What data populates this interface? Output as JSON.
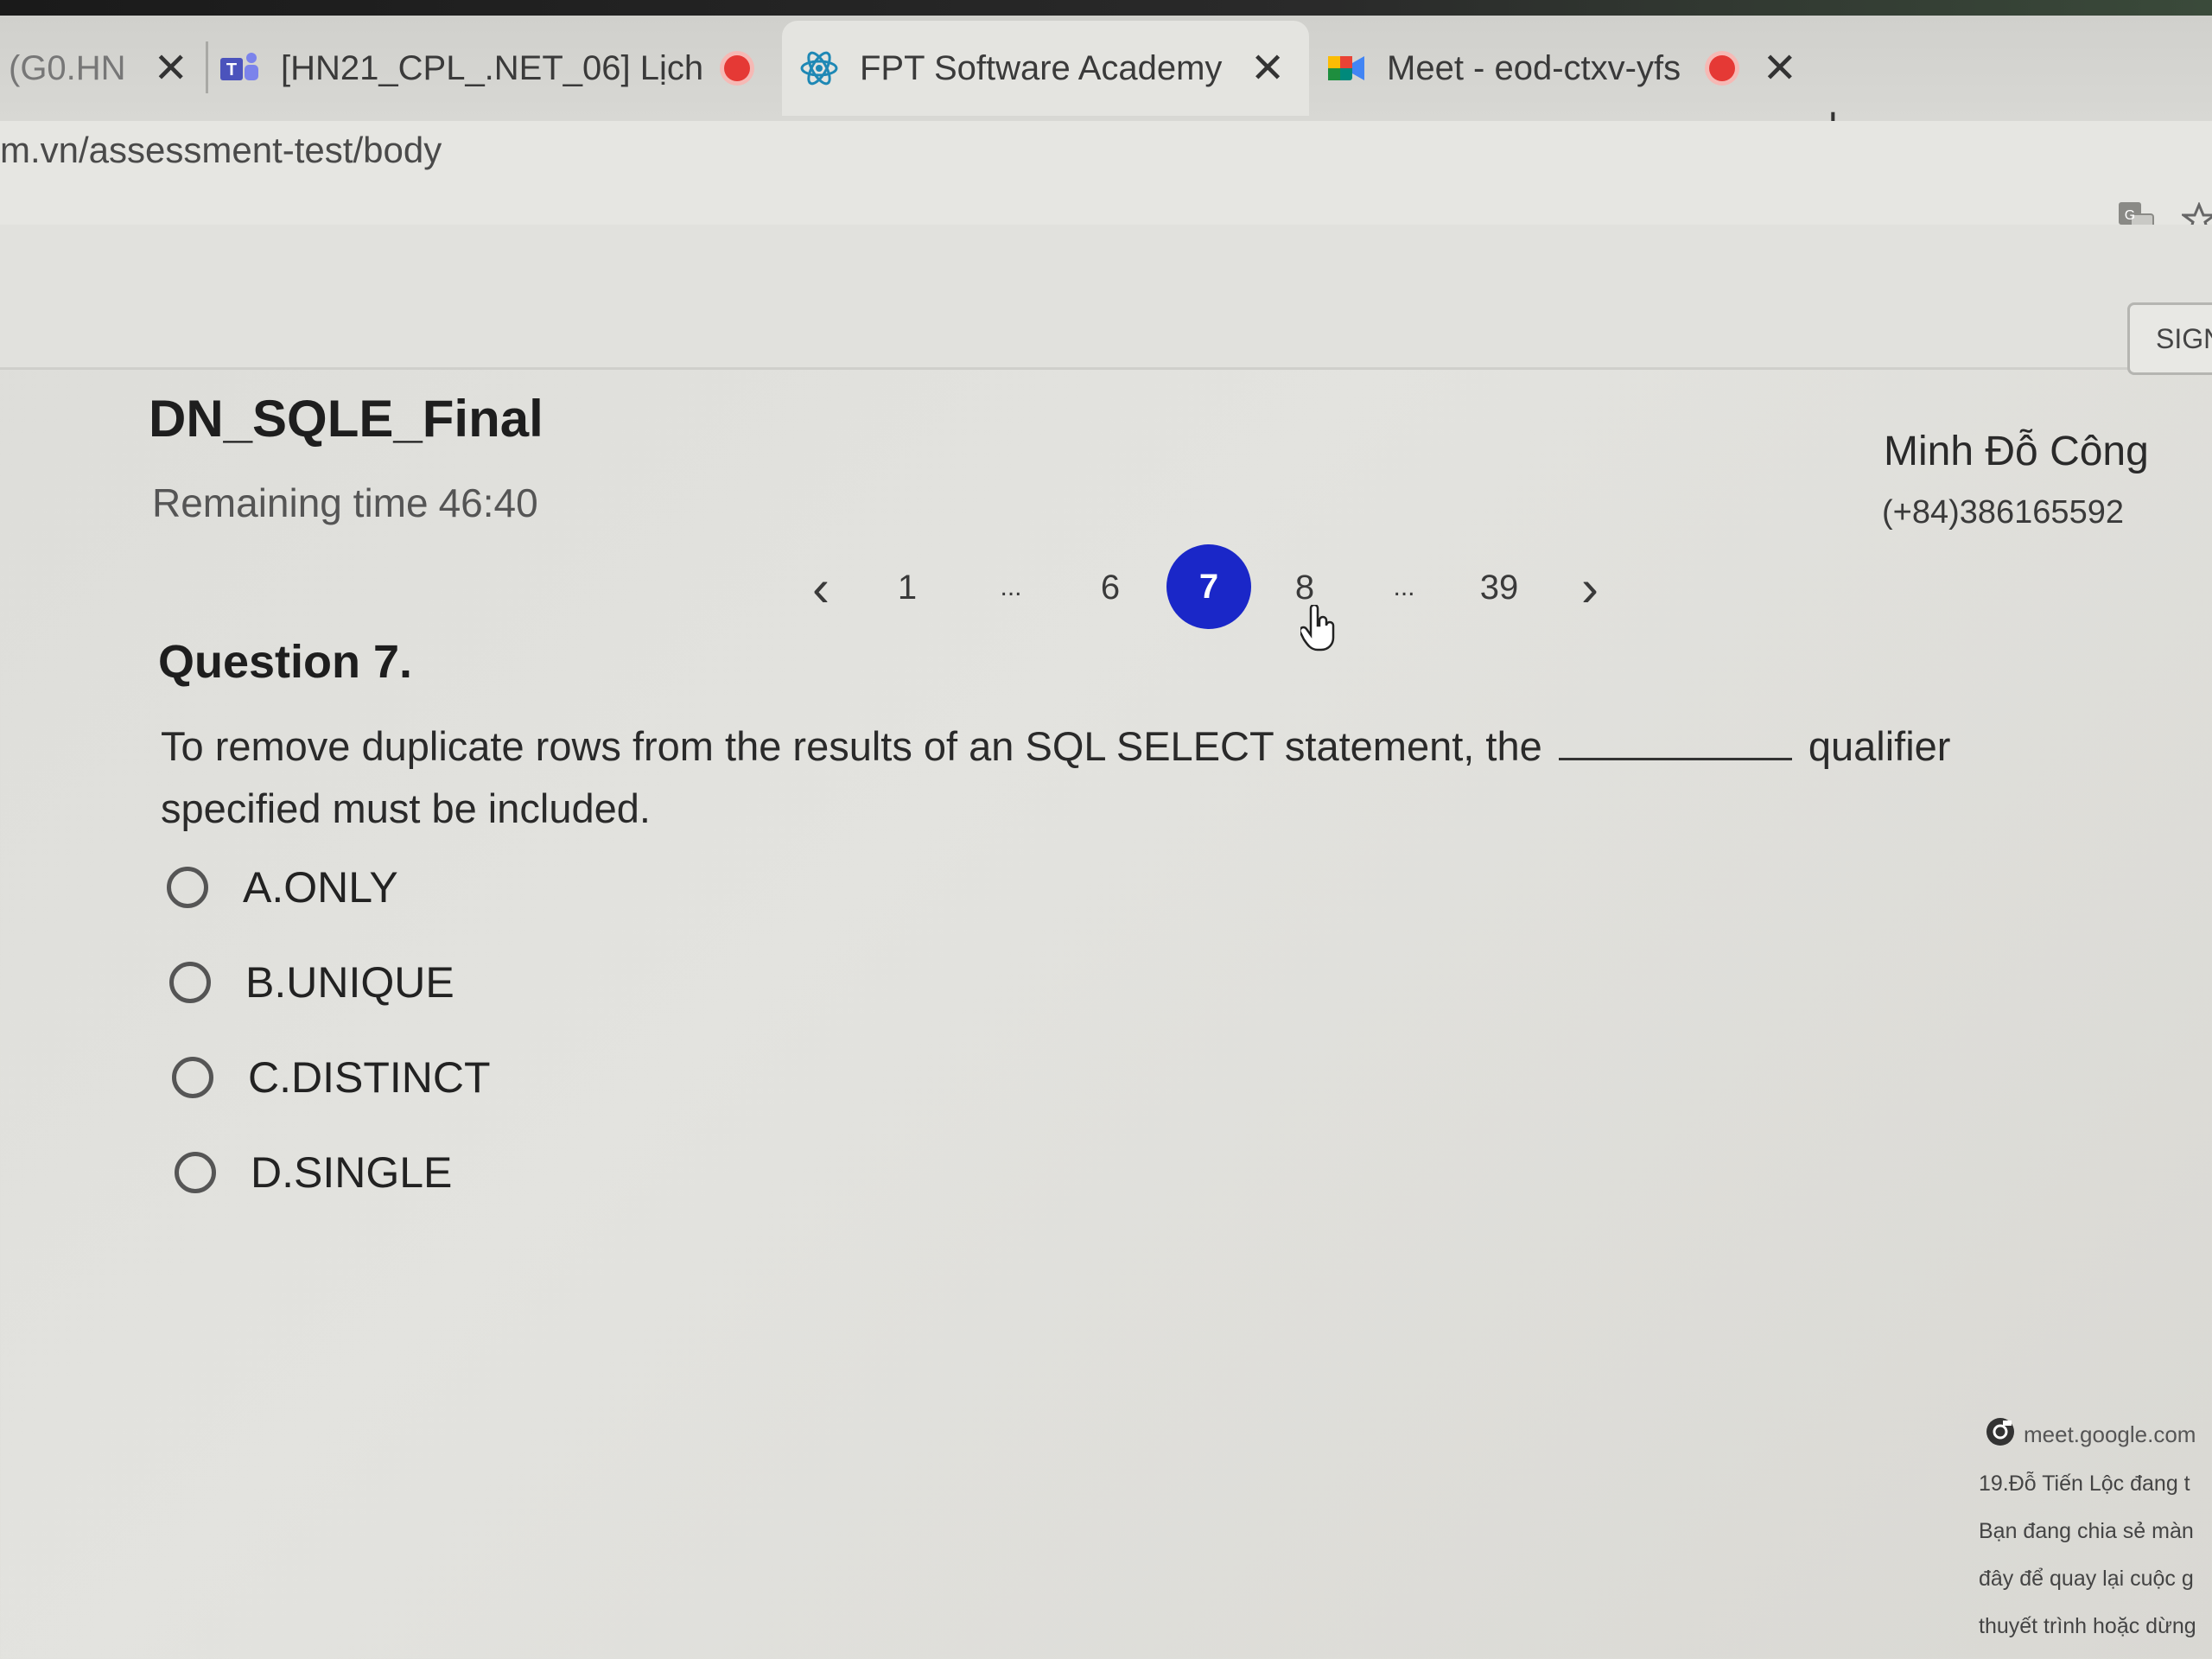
{
  "browser": {
    "tabs": [
      {
        "label": "(G0.HN",
        "icon": "page-icon",
        "recording": false
      },
      {
        "label": "[HN21_CPL_.NET_06] Lịch",
        "icon": "teams-icon",
        "recording": true
      },
      {
        "label": "FPT Software Academy",
        "icon": "react-icon",
        "recording": false
      },
      {
        "label": "Meet - eod-ctxv-yfs",
        "icon": "meet-icon",
        "recording": true
      }
    ],
    "new_tab": "+",
    "close_glyph": "✕",
    "url": "m.vn/assessment-test/body",
    "sign_button": "SIGN"
  },
  "test": {
    "title": "DN_SQLE_Final",
    "remaining_label": "Remaining time",
    "remaining_value": "46:40"
  },
  "user": {
    "name": "Minh Đỗ Công",
    "phone": "(+84)386165592"
  },
  "pagination": {
    "prev": "‹",
    "next": "›",
    "items": [
      "1",
      "...",
      "6",
      "7",
      "8",
      "...",
      "39"
    ],
    "current": "7"
  },
  "question": {
    "title": "Question 7.",
    "text_before": "To remove duplicate rows from the results of an SQL SELECT statement, the",
    "text_after": "qualifier specified must be included.",
    "options": [
      {
        "label": "A.ONLY"
      },
      {
        "label": "B.UNIQUE"
      },
      {
        "label": "C.DISTINCT"
      },
      {
        "label": "D.SINGLE"
      }
    ]
  },
  "meet_notice": {
    "domain": "meet.google.com",
    "lines": [
      "19.Đỗ Tiến Lộc đang t",
      "Bạn đang chia sẻ màn",
      "đây để quay lại cuộc g",
      "thuyết trình hoặc dừng"
    ]
  },
  "colors": {
    "accent": "#1a27c8",
    "recording": "#e53935"
  }
}
